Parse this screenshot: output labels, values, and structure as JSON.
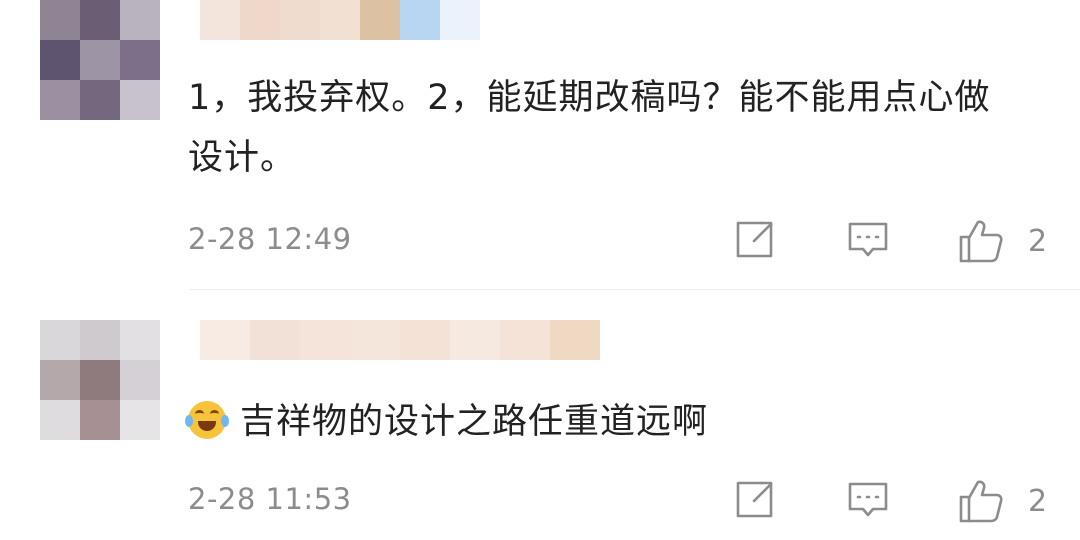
{
  "comments": [
    {
      "text": "1，我投弃权。2，能延期改稿吗？能不能用点心做设计。",
      "time": "2-28 12:49",
      "likes": "2",
      "avatar_tiles": [
        "#8e8494",
        "#6a5d74",
        "#b9b3bf",
        "#5f5470",
        "#9d94a6",
        "#7d6f8a",
        "#9a90a2",
        "#74687f",
        "#c7c2cc"
      ],
      "name_tiles": [
        "#f3e5dc",
        "#efd7c9",
        "#f0dccf",
        "#f2e0d2",
        "#dcc1a3",
        "#b8d6f1",
        "#eaf2fb"
      ]
    },
    {
      "text": "吉祥物的设计之路任重道远啊",
      "emoji": "laughing-crying-emoji",
      "time": "2-28 11:53",
      "likes": "2",
      "avatar_tiles": [
        "#d9d7d9",
        "#cfcace",
        "#e2e0e3",
        "#b5a8ab",
        "#8f7b7e",
        "#d5d0d5",
        "#dedcdf",
        "#a79094",
        "#e6e4e6"
      ],
      "name_tiles": [
        "#f7ebe3",
        "#f2e1d6",
        "#f4e4d9",
        "#f5e6dc",
        "#f3e2d5",
        "#f6e9df",
        "#f4e3d6",
        "#f0d9c2"
      ]
    }
  ],
  "icons": {
    "share": "share-icon",
    "reply": "comment-icon",
    "like": "thumbs-up-icon"
  }
}
